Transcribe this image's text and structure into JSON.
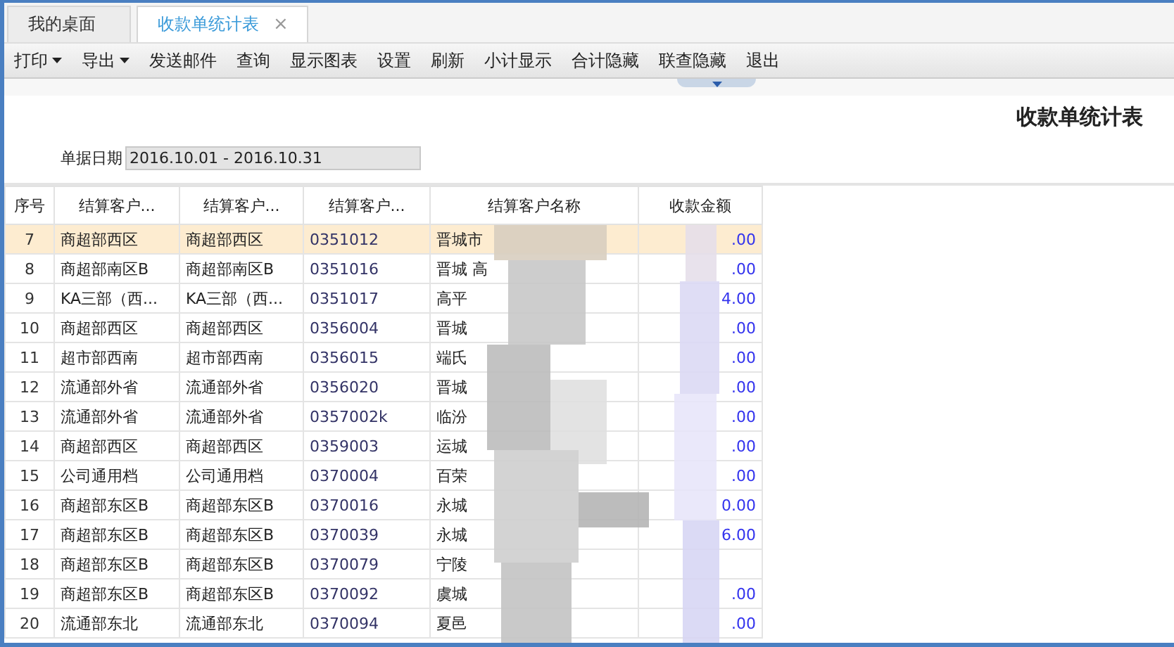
{
  "tabs": [
    {
      "label": "我的桌面",
      "selected": false
    },
    {
      "label": "收款单统计表",
      "selected": true,
      "close_glyph": "×"
    }
  ],
  "toolbar": [
    {
      "label": "打印",
      "dropdown": true
    },
    {
      "label": "导出",
      "dropdown": true
    },
    {
      "label": "发送邮件",
      "dropdown": false
    },
    {
      "label": "查询",
      "dropdown": false
    },
    {
      "label": "显示图表",
      "dropdown": false
    },
    {
      "label": "设置",
      "dropdown": false
    },
    {
      "label": "刷新",
      "dropdown": false
    },
    {
      "label": "小计显示",
      "dropdown": false
    },
    {
      "label": "合计隐藏",
      "dropdown": false
    },
    {
      "label": "联查隐藏",
      "dropdown": false
    },
    {
      "label": "退出",
      "dropdown": false
    }
  ],
  "report_title": "收款单统计表",
  "filter": {
    "label": "单据日期",
    "value": "2016.10.01 - 2016.10.31"
  },
  "table": {
    "columns": [
      "序号",
      "结算客户...",
      "结算客户...",
      "结算客户...",
      "结算客户名称",
      "收款金额"
    ],
    "rows": [
      {
        "cells": [
          "7",
          "商超部西区",
          "商超部西区",
          "0351012",
          "晋城市",
          ".00"
        ],
        "selected": true
      },
      {
        "cells": [
          "8",
          "商超部南区B",
          "商超部南区B",
          "0351016",
          "晋城 高",
          ".00"
        ],
        "selected": false
      },
      {
        "cells": [
          "9",
          "KA三部（西...",
          "KA三部（西...",
          "0351017",
          "高平",
          "4.00"
        ],
        "selected": false
      },
      {
        "cells": [
          "10",
          "商超部西区",
          "商超部西区",
          "0356004",
          "晋城",
          ".00"
        ],
        "selected": false
      },
      {
        "cells": [
          "11",
          "超市部西南",
          "超市部西南",
          "0356015",
          "端氏",
          ".00"
        ],
        "selected": false
      },
      {
        "cells": [
          "12",
          "流通部外省",
          "流通部外省",
          "0356020",
          "晋城",
          ".00"
        ],
        "selected": false
      },
      {
        "cells": [
          "13",
          "流通部外省",
          "流通部外省",
          "0357002k",
          "临汾",
          ".00"
        ],
        "selected": false
      },
      {
        "cells": [
          "14",
          "商超部西区",
          "商超部西区",
          "0359003",
          "运城",
          ".00"
        ],
        "selected": false
      },
      {
        "cells": [
          "15",
          "公司通用档",
          "公司通用档",
          "0370004",
          "百荣",
          ".00"
        ],
        "selected": false
      },
      {
        "cells": [
          "16",
          "商超部东区B",
          "商超部东区B",
          "0370016",
          "永城",
          "0.00"
        ],
        "selected": false
      },
      {
        "cells": [
          "17",
          "商超部东区B",
          "商超部东区B",
          "0370039",
          "永城",
          "6.00"
        ],
        "selected": false
      },
      {
        "cells": [
          "18",
          "商超部东区B",
          "商超部东区B",
          "0370079",
          "宁陵",
          ""
        ],
        "selected": false
      },
      {
        "cells": [
          "19",
          "商超部东区B",
          "商超部东区B",
          "0370092",
          "虞城",
          ".00"
        ],
        "selected": false
      },
      {
        "cells": [
          "20",
          "流通部东北",
          "流通部东北",
          "0370094",
          "夏邑",
          ".00"
        ],
        "selected": false
      }
    ]
  }
}
